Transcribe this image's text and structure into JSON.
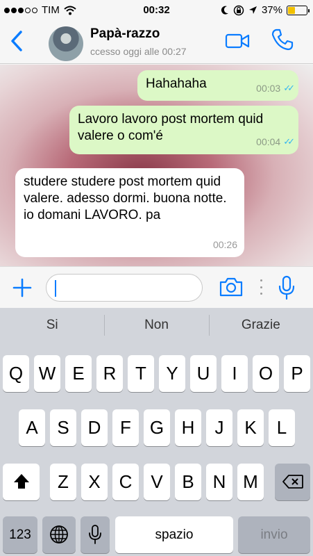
{
  "status_bar": {
    "carrier": "TIM",
    "time": "00:32",
    "battery_percent": "37%",
    "battery_level": 0.37,
    "signal_bars": 3
  },
  "header": {
    "contact_name": "Papà-razzo",
    "last_seen": "ccesso oggi alle 00:27"
  },
  "messages": [
    {
      "direction": "out",
      "text": "Hahahaha",
      "time": "00:03",
      "read": true
    },
    {
      "direction": "out",
      "text": "Lavoro lavoro post mortem quid valere o com'é",
      "time": "00:04",
      "read": true
    },
    {
      "direction": "in",
      "text": "studere studere post mortem quid valere.  adesso dormi.  buona notte.  io domani LAVORO. pa",
      "time": "00:26"
    }
  ],
  "input": {
    "value": "",
    "placeholder": ""
  },
  "suggestions": [
    "Si",
    "Non",
    "Grazie"
  ],
  "keyboard": {
    "row1": [
      "Q",
      "W",
      "E",
      "R",
      "T",
      "Y",
      "U",
      "I",
      "O",
      "P"
    ],
    "row2": [
      "A",
      "S",
      "D",
      "F",
      "G",
      "H",
      "J",
      "K",
      "L"
    ],
    "row3": [
      "Z",
      "X",
      "C",
      "V",
      "B",
      "N",
      "M"
    ],
    "numbers_key": "123",
    "space_key": "spazio",
    "return_key": "invio"
  },
  "colors": {
    "accent": "#0a7cff",
    "outgoing_bubble": "#dcf8c6",
    "incoming_bubble": "#ffffff",
    "read_ticks": "#34b7f1"
  }
}
